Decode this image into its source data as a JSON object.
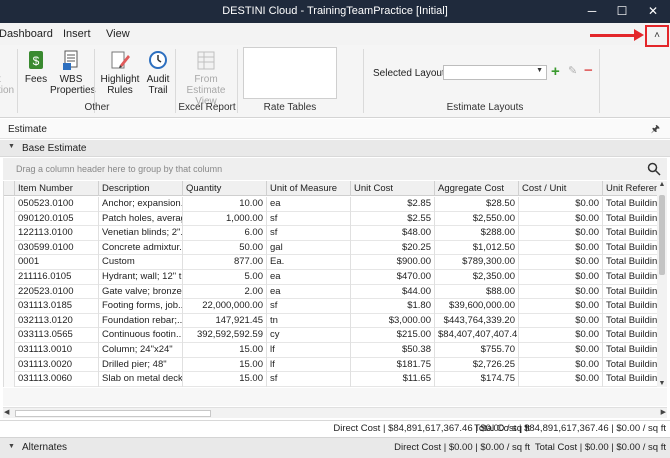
{
  "window": {
    "title": "DESTINI Cloud - TrainingTeamPractice [Initial]",
    "minimize": "─",
    "maximize": "☐",
    "close": "✕"
  },
  "menu": {
    "items": [
      "Dashboard",
      "Insert",
      "View"
    ]
  },
  "ribbon": {
    "cut_btn_lines": [
      "t",
      "tion"
    ],
    "fees": "Fees",
    "wbs": [
      "WBS",
      "Properties"
    ],
    "highlight": [
      "Highlight",
      "Rules"
    ],
    "audit": [
      "Audit",
      "Trail"
    ],
    "from_estimate": [
      "From Estimate",
      "View"
    ],
    "groups": {
      "other": "Other",
      "excel": "Excel Report",
      "rate_tables": "Rate Tables",
      "layouts": "Estimate Layouts"
    },
    "selected_layout_label": "Selected Layout",
    "selected_layout_value": "",
    "collapse_glyph": "˄"
  },
  "estimate": {
    "panel_title": "Estimate",
    "pin_glyph": "🖈",
    "base_title": "Base Estimate",
    "group_hint": "Drag a column header here to group by that column",
    "columns": [
      "Item Number",
      "Description",
      "Quantity",
      "Unit of Measure",
      "Unit Cost",
      "Aggregate Cost",
      "Cost / Unit",
      "Unit Reference"
    ],
    "rows": [
      [
        "050523.0100",
        "Anchor; expansion...",
        "10.00",
        "ea",
        "$2.85",
        "$28.50",
        "$0.00",
        "Total Building A"
      ],
      [
        "090120.0105",
        "Patch holes, averag...",
        "1,000.00",
        "sf",
        "$2.55",
        "$2,550.00",
        "$0.00",
        "Total Building A"
      ],
      [
        "122113.0100",
        "Venetian blinds; 2\"...",
        "6.00",
        "sf",
        "$48.00",
        "$288.00",
        "$0.00",
        "Total Building A"
      ],
      [
        "030599.0100",
        "Concrete admixtur...",
        "50.00",
        "gal",
        "$20.25",
        "$1,012.50",
        "$0.00",
        "Total Building A"
      ],
      [
        "0001",
        "Custom",
        "877.00",
        "Ea.",
        "$900.00",
        "$789,300.00",
        "$0.00",
        "Total Building A"
      ],
      [
        "211116.0105",
        "Hydrant; wall; 12\" t...",
        "5.00",
        "ea",
        "$470.00",
        "$2,350.00",
        "$0.00",
        "Total Building A"
      ],
      [
        "220523.0100",
        "Gate valve; bronze;...",
        "2.00",
        "ea",
        "$44.00",
        "$88.00",
        "$0.00",
        "Total Building A"
      ],
      [
        "031113.0185",
        "Footing forms, job...",
        "22,000,000.00",
        "sf",
        "$1.80",
        "$39,600,000.00",
        "$0.00",
        "Total Building A"
      ],
      [
        "032113.0120",
        "Foundation rebar;...",
        "147,921.45",
        "tn",
        "$3,000.00",
        "$443,764,339.20",
        "$0.00",
        "Total Building A"
      ],
      [
        "033113.0565",
        "Continuous footin...",
        "392,592,592.59",
        "cy",
        "$215.00",
        "$84,407,407,407.41",
        "$0.00",
        "Total Building A"
      ],
      [
        "031113.0010",
        "Column; 24\"x24\"",
        "15.00",
        "lf",
        "$50.38",
        "$755.70",
        "$0.00",
        "Total Building A"
      ],
      [
        "031113.0020",
        "Drilled pier; 48\"",
        "15.00",
        "lf",
        "$181.75",
        "$2,726.25",
        "$0.00",
        "Total Building A"
      ],
      [
        "031113.0060",
        "Slab on metal deck...",
        "15.00",
        "sf",
        "$11.65",
        "$174.75",
        "$0.00",
        "Total Building A"
      ]
    ],
    "totals_direct": "Direct Cost | $84,891,617,367.46 | $0.00 / sq ft",
    "totals_total": "Total Cost | $84,891,617,367.46 | $0.00 / sq ft"
  },
  "alternates": {
    "title": "Alternates",
    "direct": "Direct Cost | $0.00 | $0.00 / sq ft",
    "total": "Total Cost | $0.00 | $0.00 / sq ft"
  },
  "colors": {
    "titlebar": "#1f2a3c",
    "highlight": "#e3262a",
    "add": "#3a9a2e",
    "remove": "#e06060"
  }
}
